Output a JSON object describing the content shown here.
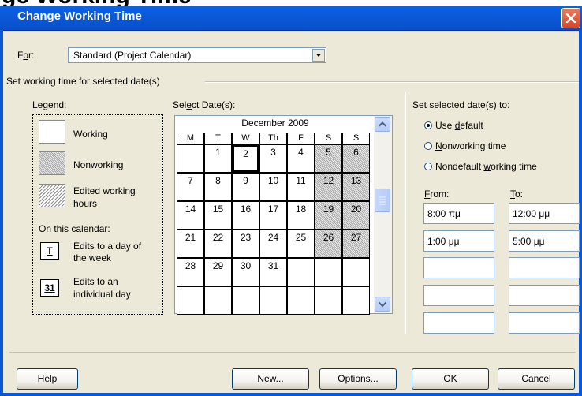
{
  "header_strip": {
    "text": "ge Working Time"
  },
  "window": {
    "title": "Change Working Time"
  },
  "for_field": {
    "label_prefix": "F",
    "label_accel": "o",
    "label_suffix": "r:",
    "value": "Standard (Project Calendar)"
  },
  "group": {
    "title": "Set working time for selected date(s)"
  },
  "legend": {
    "title": "Legend:",
    "items": [
      {
        "label": "Working"
      },
      {
        "label": "Nonworking"
      },
      {
        "label_line1": "Edited working",
        "label_line2": "hours"
      }
    ],
    "on_this_calendar": "On this calendar:",
    "day_of_week": {
      "badge": "T",
      "line1": "Edits to a day of",
      "line2": "the week"
    },
    "individual_day": {
      "badge": "31",
      "line1": "Edits to an",
      "line2": "individual day"
    }
  },
  "calendar": {
    "label_prefix": "Sel",
    "label_accel": "e",
    "label_suffix": "ct Date(s):",
    "month": "December 2009",
    "weekdays": [
      "M",
      "T",
      "W",
      "Th",
      "F",
      "S",
      "S"
    ],
    "weeks": [
      [
        "",
        "1",
        "2",
        "3",
        "4",
        "5",
        "6"
      ],
      [
        "7",
        "8",
        "9",
        "10",
        "11",
        "12",
        "13"
      ],
      [
        "14",
        "15",
        "16",
        "17",
        "18",
        "19",
        "20"
      ],
      [
        "21",
        "22",
        "23",
        "24",
        "25",
        "26",
        "27"
      ],
      [
        "28",
        "29",
        "30",
        "31",
        "",
        "",
        ""
      ],
      [
        "",
        "",
        "",
        "",
        "",
        "",
        ""
      ]
    ],
    "selected_date": "2"
  },
  "set_dates": {
    "title": "Set selected date(s) to:",
    "options": [
      {
        "pre": "Use ",
        "accel": "d",
        "post": "efault",
        "selected": true
      },
      {
        "pre": "",
        "accel": "N",
        "post": "onworking time",
        "selected": false
      },
      {
        "pre": "Nondefault ",
        "accel": "w",
        "post": "orking time",
        "selected": false
      }
    ]
  },
  "times": {
    "from_label_accel": "F",
    "from_label_rest": "rom:",
    "to_label_accel": "T",
    "to_label_rest": "o:",
    "rows": [
      {
        "from": "8:00 πμ",
        "to": "12:00 μμ"
      },
      {
        "from": "1:00 μμ",
        "to": "5:00 μμ"
      },
      {
        "from": "",
        "to": ""
      },
      {
        "from": "",
        "to": ""
      },
      {
        "from": "",
        "to": ""
      }
    ]
  },
  "buttons": {
    "help": {
      "accel": "H",
      "rest": "elp"
    },
    "new": {
      "pre": "N",
      "accel": "e",
      "post": "w..."
    },
    "options": {
      "pre": "O",
      "accel": "p",
      "post": "tions..."
    },
    "ok": "OK",
    "cancel": "Cancel"
  },
  "icons": {
    "close": "close-icon",
    "dropdown": "chevron-down-icon",
    "scroll_up": "arrow-up-icon",
    "scroll_down": "arrow-down-icon",
    "grip": "grip-icon"
  },
  "colors": {
    "titlebar": "#0a58d6",
    "dialog_bg": "#ece9d8",
    "close": "#d4482a"
  }
}
